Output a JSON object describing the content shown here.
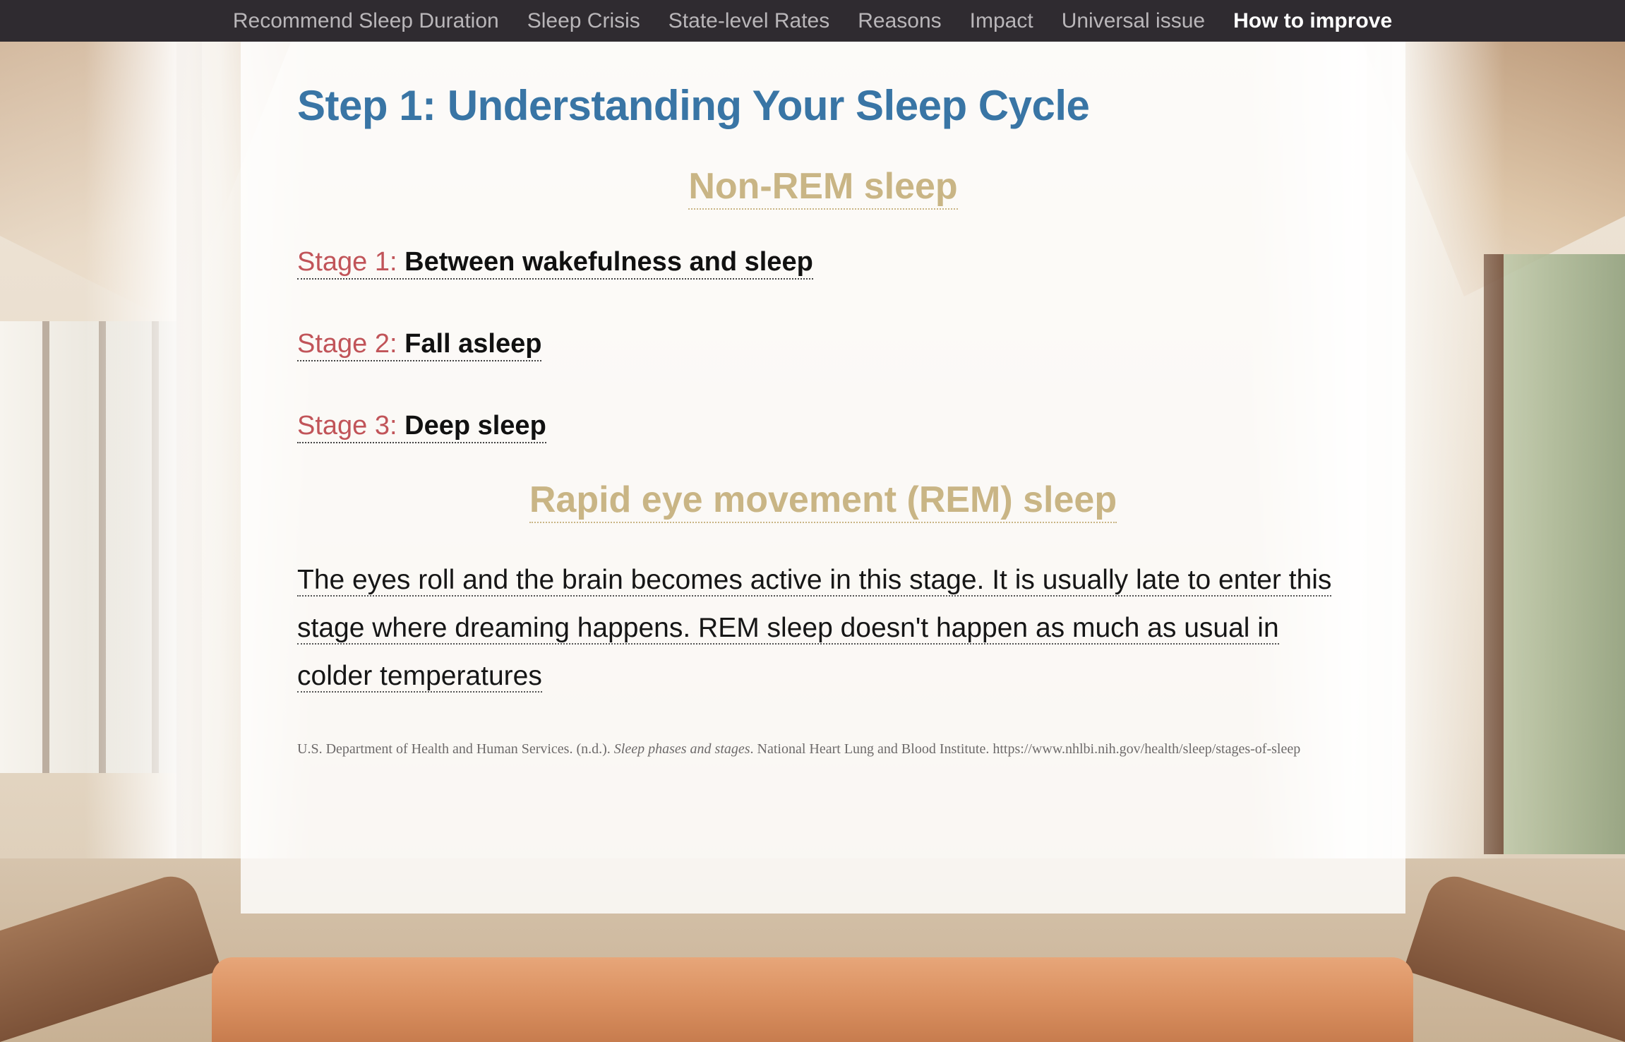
{
  "nav": {
    "items": [
      {
        "label": "Recommend Sleep Duration",
        "active": false
      },
      {
        "label": "Sleep Crisis",
        "active": false
      },
      {
        "label": "State-level Rates",
        "active": false
      },
      {
        "label": "Reasons",
        "active": false
      },
      {
        "label": "Impact",
        "active": false
      },
      {
        "label": "Universal issue",
        "active": false
      },
      {
        "label": "How to improve",
        "active": true
      }
    ]
  },
  "content": {
    "title": "Step 1: Understanding Your Sleep Cycle",
    "non_rem_heading": "Non-REM sleep",
    "stages": [
      {
        "label": "Stage 1:",
        "text": "Between wakefulness and sleep"
      },
      {
        "label": "Stage 2:",
        "text": "Fall asleep"
      },
      {
        "label": "Stage 3:",
        "text": "Deep sleep"
      }
    ],
    "rem_heading": "Rapid eye movement (REM) sleep",
    "rem_description": "The eyes roll and the brain becomes active in this stage. It is usually late to enter this stage where dreaming happens. REM sleep doesn't happen as much as usual in colder temperatures",
    "citation": {
      "before": "U.S. Department of Health and Human Services. (n.d.). ",
      "italic": "Sleep phases and stages",
      "after": ". National Heart Lung and Blood Institute. https://www.nhlbi.nih.gov/health/sleep/stages-of-sleep"
    }
  },
  "colors": {
    "nav_background": "#2f2b30",
    "nav_text": "#b9b6b9",
    "nav_active": "#ffffff",
    "title": "#3975a5",
    "subheading": "#c9b585",
    "stage_label": "#c15459"
  }
}
